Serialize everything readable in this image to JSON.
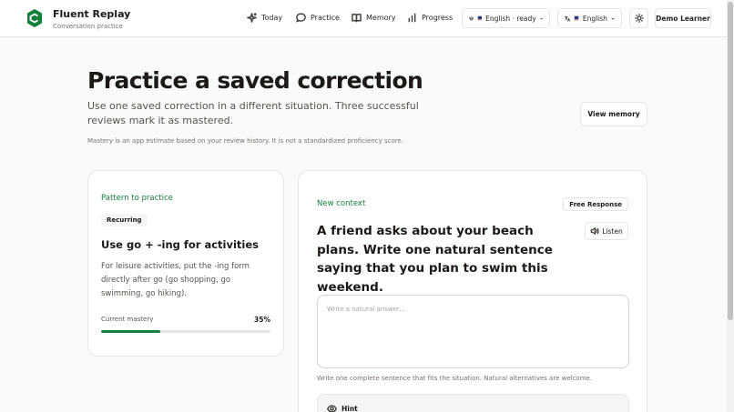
{
  "header": {
    "brand_name": "Fluent Replay",
    "brand_subtitle": "Conversation practice",
    "nav": [
      {
        "label": "Today",
        "icon": "sparkle-icon"
      },
      {
        "label": "Practice",
        "icon": "chat-bubble-icon"
      },
      {
        "label": "Memory",
        "icon": "book-icon"
      },
      {
        "label": "Progress",
        "icon": "bar-chart-icon"
      }
    ],
    "model_status": "English · ready",
    "language": "English",
    "user": "Demo Learner"
  },
  "page": {
    "title": "Practice a saved correction",
    "description": "Use one saved correction in a different situation. Three successful reviews mark it as mastered.",
    "view_memory_label": "View memory",
    "mastery_note": "Mastery is an app estimate based on your review history. It is not a standardized proficiency score."
  },
  "pattern_card": {
    "section_label": "Pattern to practice",
    "badge": "Recurring",
    "title": "Use go + -ing for activities",
    "description": "For leisure activities, put the -ing form directly after go (go shopping, go swimming, go hiking).",
    "mastery_label": "Current mastery",
    "mastery_value": "35%",
    "mastery_fraction": 0.35
  },
  "context_card": {
    "section_label": "New context",
    "badge": "Free Response",
    "prompt": "A friend asks about your beach plans. Write one natural sentence saying that you plan to swim this weekend.",
    "listen_label": "Listen",
    "answer_placeholder": "Write a natural answer...",
    "answer_value": "",
    "helper_text": "Write one complete sentence that fits the situation. Natural alternatives are welcome.",
    "hint_label": "Hint"
  },
  "colors": {
    "accent_green": "#15803d",
    "text_primary": "#1c1917",
    "text_muted": "#57534e",
    "border": "#e7e5e4"
  }
}
